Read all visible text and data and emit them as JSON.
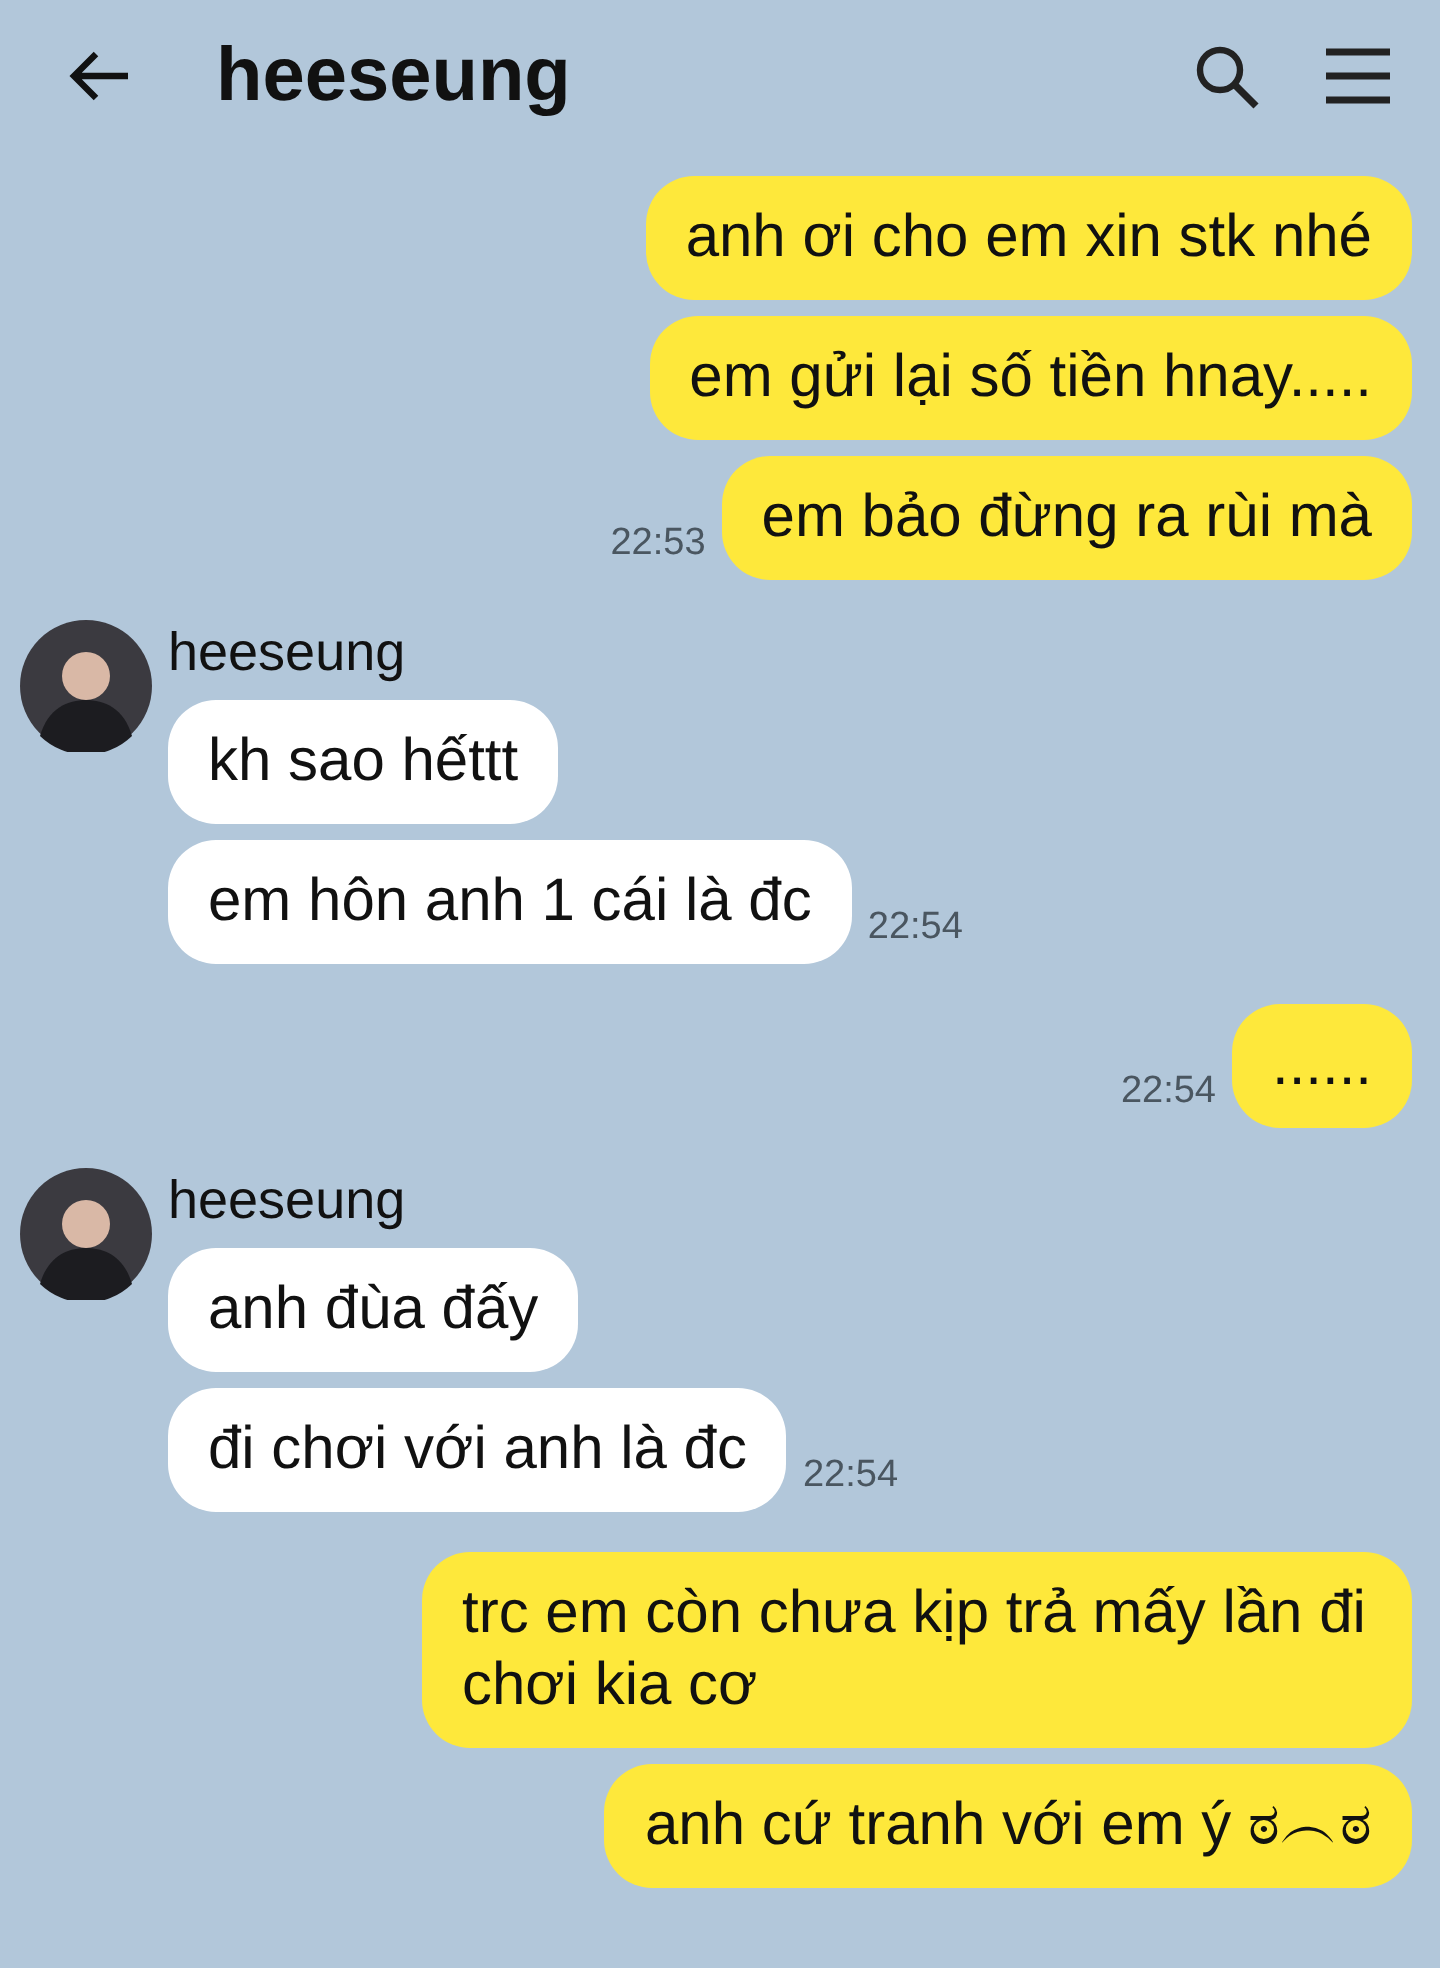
{
  "header": {
    "title": "heeseung"
  },
  "groups": [
    {
      "kind": "sent",
      "time": "22:53",
      "messages": [
        {
          "text": "anh ơi cho em xin stk nhé"
        },
        {
          "text": "em gửi lại số tiền hnay....."
        },
        {
          "text": "em bảo đừng ra rùi mà"
        }
      ]
    },
    {
      "kind": "received",
      "name": "heeseung",
      "time": "22:54",
      "messages": [
        {
          "text": "kh sao hếttt"
        },
        {
          "text": "em hôn anh 1 cái là đc"
        }
      ]
    },
    {
      "kind": "sent",
      "time": "22:54",
      "messages": [
        {
          "text": "......"
        }
      ]
    },
    {
      "kind": "received",
      "name": "heeseung",
      "time": "22:54",
      "messages": [
        {
          "text": "anh đùa đấy"
        },
        {
          "text": "đi chơi với anh là đc"
        }
      ]
    },
    {
      "kind": "sent",
      "messages": [
        {
          "text": "trc em còn chưa kịp trả mấy lần đi chơi kia cơ"
        },
        {
          "text": "anh cứ tranh với em ý ಠ︵ಠ"
        }
      ]
    }
  ]
}
